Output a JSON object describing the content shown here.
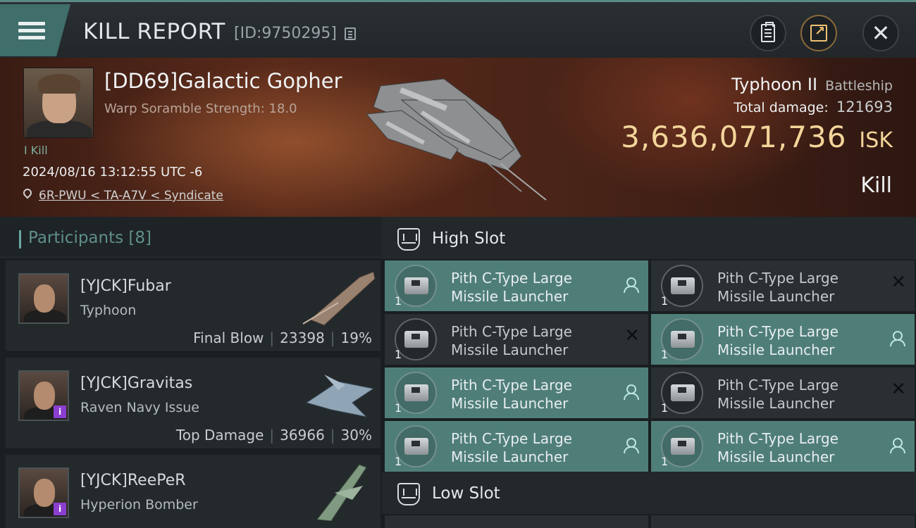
{
  "header": {
    "title": "KILL REPORT",
    "report_id": "[ID:9750295]"
  },
  "victim": {
    "name": "[DD69]Galactic Gopher",
    "subtitle": "Warp Soramble Strength: 18.0",
    "kills": "I Kill",
    "date": "2024/08/16 13:12:55 UTC -6",
    "location": "6R-PWU < TA-A7V < Syndicate",
    "ship_name": "Typhoon II",
    "ship_class": "Battleship",
    "damage_label": "Total damage:",
    "damage_value": "121693",
    "isk_value": "3,636,071,736",
    "isk_unit": "ISK",
    "result": "Kill"
  },
  "participants": {
    "title": "Participants",
    "count": "[8]",
    "items": [
      {
        "name": "[YJCK]Fubar",
        "ship": "Typhoon",
        "role": "Final Blow",
        "damage": "23398",
        "percent": "19%"
      },
      {
        "name": "[YJCK]Gravitas",
        "ship": "Raven Navy Issue",
        "role": "Top Damage",
        "damage": "36966",
        "percent": "30%"
      },
      {
        "name": "[YJCK]ReePeR",
        "ship": "Hyperion Bomber"
      }
    ]
  },
  "slots": {
    "high_title": "High Slot",
    "low_title": "Low Slot",
    "modules": [
      {
        "line1": "Pith C-Type Large",
        "line2": "Missile Launcher",
        "qty": "1",
        "state": "fitted"
      },
      {
        "line1": "Pith C-Type Large",
        "line2": "Missile Launcher",
        "qty": "1",
        "state": "destroyed"
      },
      {
        "line1": "Pith C-Type Large",
        "line2": "Missile Launcher",
        "qty": "1",
        "state": "destroyed"
      },
      {
        "line1": "Pith C-Type Large",
        "line2": "Missile Launcher",
        "qty": "1",
        "state": "fitted"
      },
      {
        "line1": "Pith C-Type Large",
        "line2": "Missile Launcher",
        "qty": "1",
        "state": "fitted"
      },
      {
        "line1": "Pith C-Type Large",
        "line2": "Missile Launcher",
        "qty": "1",
        "state": "destroyed"
      },
      {
        "line1": "Pith C-Type Large",
        "line2": "Missile Launcher",
        "qty": "1",
        "state": "fitted"
      },
      {
        "line1": "Pith C-Type Large",
        "line2": "Missile Launcher",
        "qty": "1",
        "state": "fitted"
      }
    ]
  },
  "colors": {
    "accent": "#4f7e79",
    "isk": "#f3d59a",
    "header_bar": "#3f6e6b",
    "participants_title": "#5f8f8a"
  },
  "icons": [
    "menu-icon",
    "copy-icon",
    "clipboard-icon",
    "share-icon",
    "close-icon",
    "location-pin-icon",
    "high-slot-icon",
    "low-slot-icon",
    "module-icon",
    "person-icon",
    "x-icon"
  ]
}
